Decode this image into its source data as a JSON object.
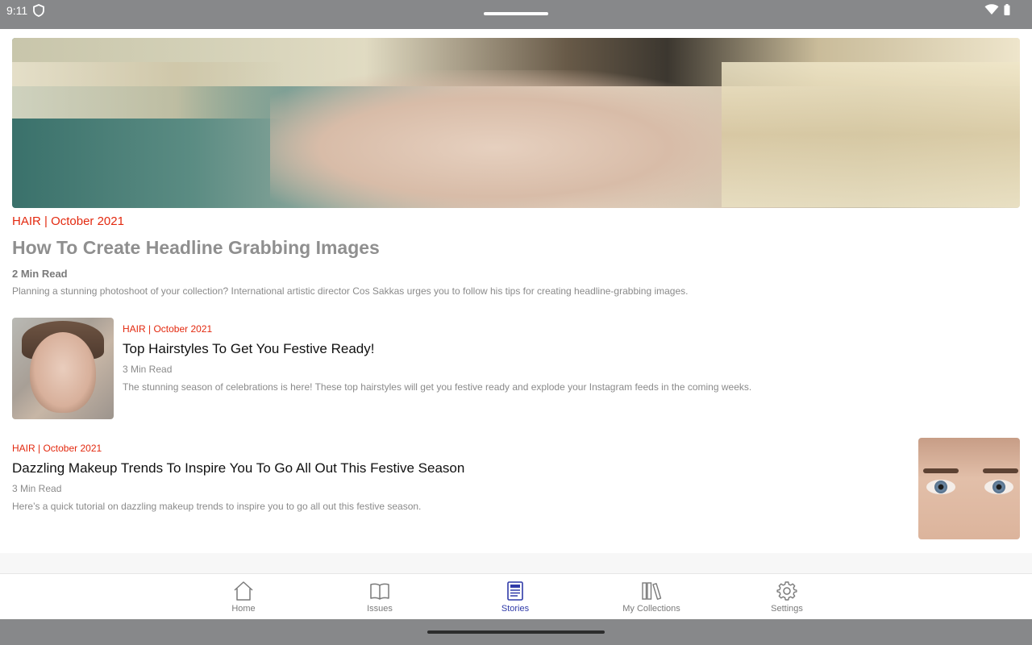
{
  "status_bar": {
    "time": "9:11"
  },
  "featured": {
    "category": "HAIR | October 2021",
    "title": "How To Create Headline Grabbing Images",
    "read_time": "2 Min Read",
    "description": "Planning a stunning photoshoot of your collection? International artistic director Cos Sakkas urges you to follow his tips for creating headline-grabbing images."
  },
  "stories": [
    {
      "category": "HAIR | October 2021",
      "title": "Top Hairstyles To Get You Festive Ready!",
      "read_time": "3 Min Read",
      "description": "The stunning season of celebrations is here! These top hairstyles will get you festive ready and explode your Instagram feeds in the coming weeks."
    },
    {
      "category": "HAIR | October 2021",
      "title": "Dazzling Makeup Trends To Inspire You To Go All Out This Festive Season",
      "read_time": "3 Min Read",
      "description": "Here’s a quick tutorial on dazzling makeup trends to inspire you to go all out this festive season."
    }
  ],
  "bottom_nav": {
    "items": [
      {
        "label": "Home",
        "icon": "home-icon"
      },
      {
        "label": "Issues",
        "icon": "book-icon"
      },
      {
        "label": "Stories",
        "icon": "stories-icon",
        "active": true
      },
      {
        "label": "My Collections",
        "icon": "collections-icon"
      },
      {
        "label": "Settings",
        "icon": "gear-icon"
      }
    ]
  },
  "colors": {
    "category_accent": "#e3290f",
    "active_nav": "#2f3aa8",
    "system_bar": "#87888a"
  }
}
